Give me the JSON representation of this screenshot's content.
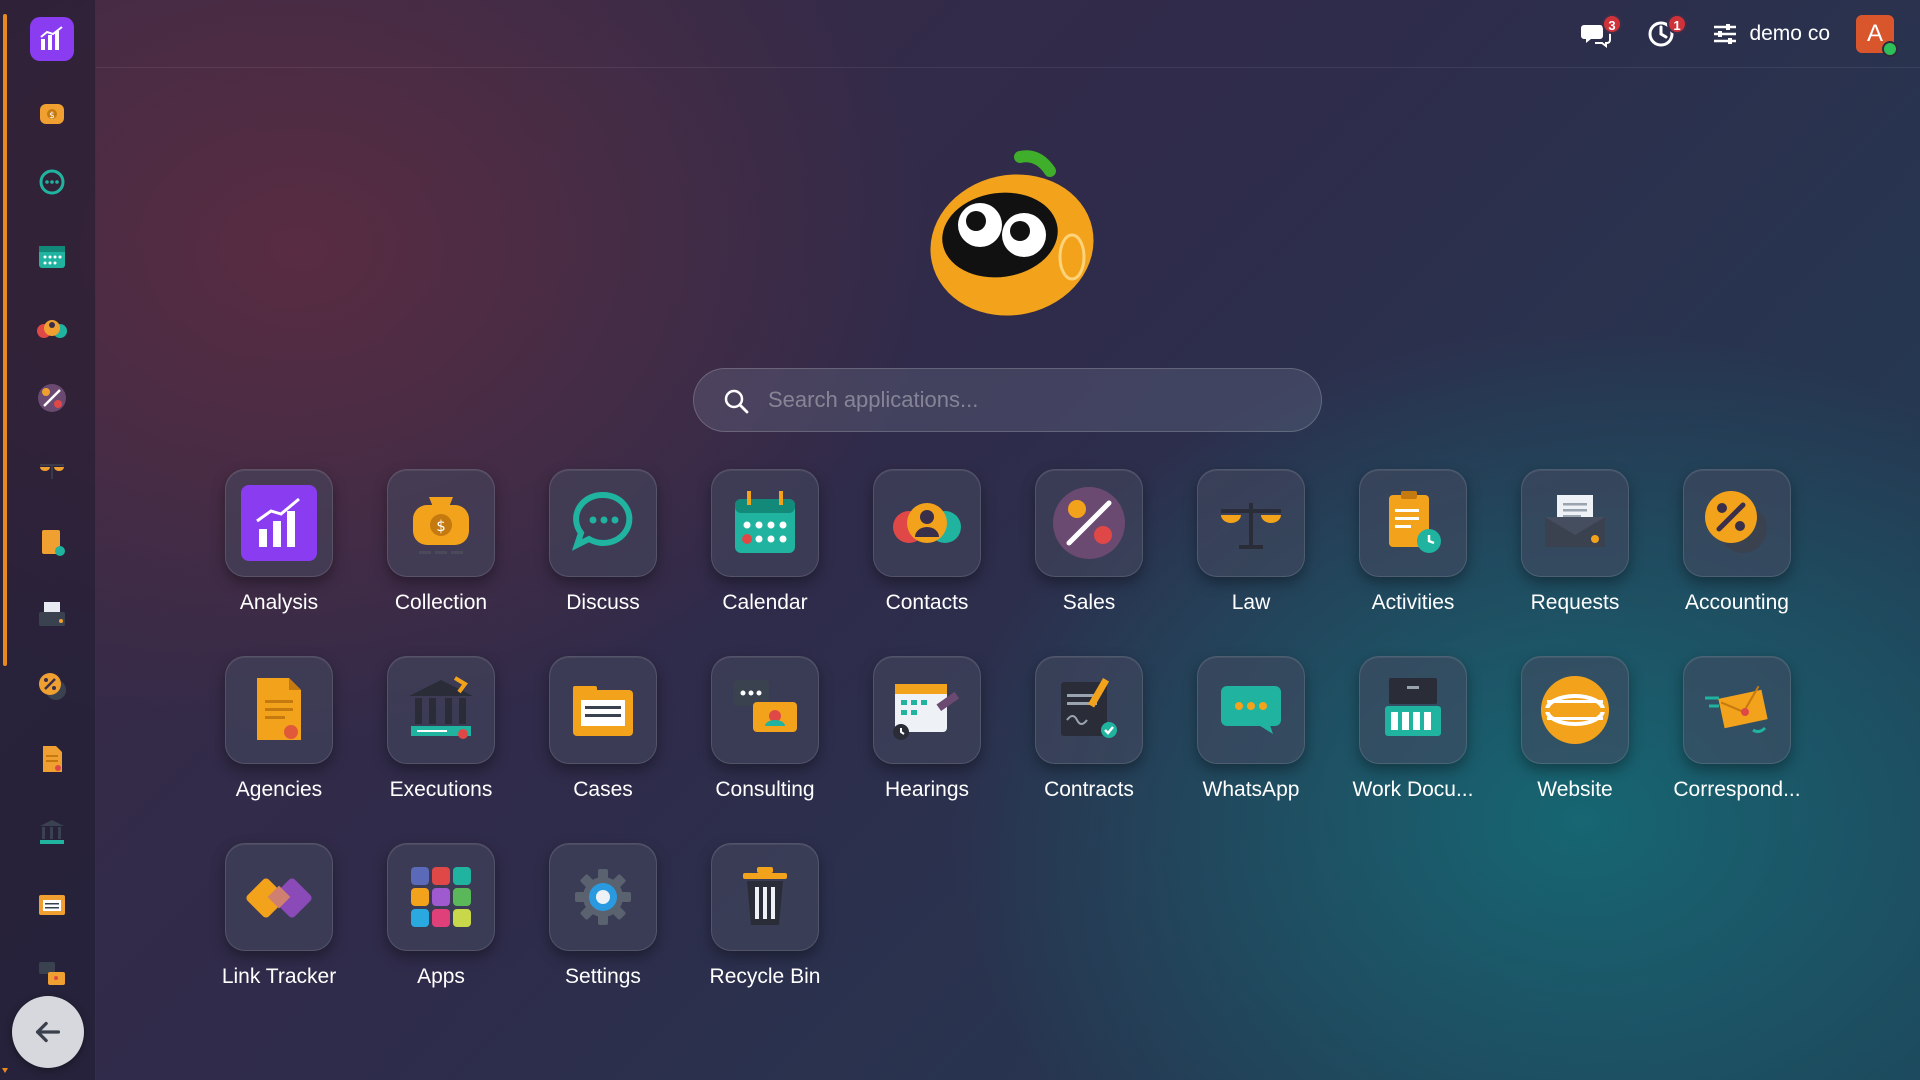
{
  "topbar": {
    "messages_badge": "3",
    "activities_badge": "1",
    "company_name": "demo co",
    "avatar_initial": "A"
  },
  "search": {
    "placeholder": "Search applications..."
  },
  "sidebar": {
    "items": [
      "analysis-icon",
      "collection-icon",
      "discuss-icon",
      "calendar-icon",
      "contacts-icon",
      "sales-icon",
      "law-icon",
      "activities-icon",
      "requests-icon",
      "accounting-icon",
      "agencies-icon",
      "executions-icon",
      "cases-icon",
      "consulting-icon"
    ]
  },
  "apps": [
    {
      "label": "Analysis"
    },
    {
      "label": "Collection"
    },
    {
      "label": "Discuss"
    },
    {
      "label": "Calendar"
    },
    {
      "label": "Contacts"
    },
    {
      "label": "Sales"
    },
    {
      "label": "Law"
    },
    {
      "label": "Activities"
    },
    {
      "label": "Requests"
    },
    {
      "label": "Accounting"
    },
    {
      "label": "Agencies"
    },
    {
      "label": "Executions"
    },
    {
      "label": "Cases"
    },
    {
      "label": "Consulting"
    },
    {
      "label": "Hearings"
    },
    {
      "label": "Contracts"
    },
    {
      "label": "WhatsApp"
    },
    {
      "label": "Work Docu..."
    },
    {
      "label": "Website"
    },
    {
      "label": "Correspond..."
    },
    {
      "label": "Link Tracker"
    },
    {
      "label": "Apps"
    },
    {
      "label": "Settings"
    },
    {
      "label": "Recycle Bin"
    }
  ],
  "colors": {
    "accent": "#8a3cf0",
    "badge": "#d0323a",
    "scrollbar": "#e8891e",
    "avatar": "#d9562c"
  }
}
